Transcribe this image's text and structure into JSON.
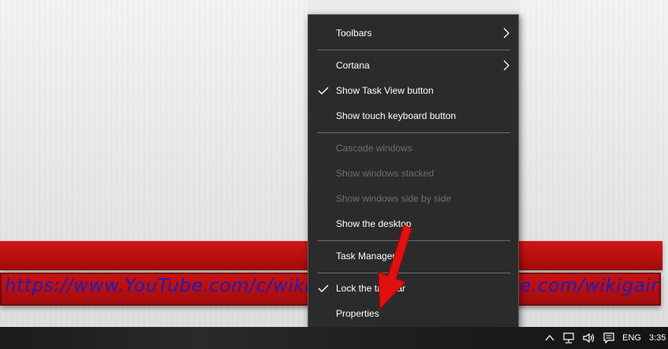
{
  "banner": {
    "url_text_left": "https://www.YouTube.com/c/wikigain",
    "url_text_right": "be.com/wikigain"
  },
  "context_menu": {
    "items": [
      {
        "label": "Toolbars",
        "checked": false,
        "submenu": true,
        "disabled": false
      },
      {
        "label": "Cortana",
        "checked": false,
        "submenu": true,
        "disabled": false
      },
      {
        "label": "Show Task View button",
        "checked": true,
        "submenu": false,
        "disabled": false
      },
      {
        "label": "Show touch keyboard button",
        "checked": false,
        "submenu": false,
        "disabled": false
      },
      {
        "label": "Cascade windows",
        "checked": false,
        "submenu": false,
        "disabled": true
      },
      {
        "label": "Show windows stacked",
        "checked": false,
        "submenu": false,
        "disabled": true
      },
      {
        "label": "Show windows side by side",
        "checked": false,
        "submenu": false,
        "disabled": true
      },
      {
        "label": "Show the desktop",
        "checked": false,
        "submenu": false,
        "disabled": false
      },
      {
        "label": "Task Manager",
        "checked": false,
        "submenu": false,
        "disabled": false
      },
      {
        "label": "Lock the taskbar",
        "checked": true,
        "submenu": false,
        "disabled": false
      },
      {
        "label": "Properties",
        "checked": false,
        "submenu": false,
        "disabled": false
      }
    ]
  },
  "taskbar": {
    "language": "ENG",
    "clock": "3:35",
    "tray_icons": [
      "chevron-up-icon",
      "network-icon",
      "volume-icon",
      "notification-icon"
    ]
  },
  "colors": {
    "menu_bg": "#2b2b2b",
    "banner_red": "#b80e0e",
    "annotation_arrow": "#e01010",
    "banner_text": "#1d1db8"
  }
}
